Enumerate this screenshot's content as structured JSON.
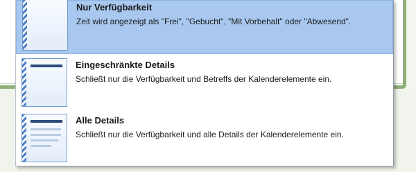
{
  "menu": {
    "items": [
      {
        "title": "Nur Verfügbarkeit",
        "description": "Zeit wird angezeigt als \"Frei\", \"Gebucht\", \"Mit Vorbehalt\" oder \"Abwesend\".",
        "icon": "free-busy-only-icon",
        "selected": true
      },
      {
        "title": "Eingeschränkte Details",
        "description": "Schließt nur die Verfügbarkeit und Betreffs der Kalenderelemente ein.",
        "icon": "limited-details-icon",
        "selected": false
      },
      {
        "title": "Alle Details",
        "description": "Schließt nur die Verfügbarkeit und alle Details der Kalenderelemente ein.",
        "icon": "full-details-icon",
        "selected": false
      }
    ]
  },
  "colors": {
    "selected_background": "#a9c8ef",
    "icon_border": "#6f9bd0",
    "icon_dark_bar": "#2f4b7c",
    "background_window_border": "#8fae78"
  }
}
